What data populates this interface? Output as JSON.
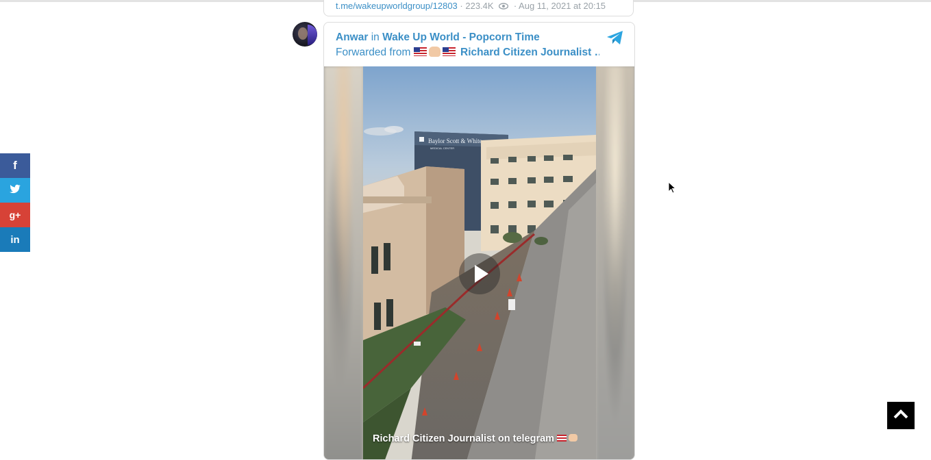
{
  "previous_post": {
    "link": "t.me/wakeupworldgroup/12803",
    "views": "223.4K",
    "date": "Aug 11, 2021 at 20:15"
  },
  "post": {
    "author": "Anwar",
    "in_label": "in",
    "group": "Wake Up World - Popcorn Time",
    "forwarded_label": "Forwarded from",
    "forwarded_source": "Richard Citizen Journalist …",
    "media": {
      "type": "video",
      "caption": "Richard Citizen Journalist on telegram",
      "building_sign": "Baylor Scott & White",
      "building_sign_sub": "MEDICAL CENTER"
    }
  },
  "share_bar": {
    "facebook": "f",
    "twitter": "twitter-icon",
    "googleplus": "g+",
    "linkedin": "in"
  },
  "icons": {
    "platform": "telegram-icon",
    "back_to_top": "chevron-up-icon",
    "views": "eye-icon"
  },
  "colors": {
    "link": "#3b8fc6",
    "facebook": "#3b5b9a",
    "twitter": "#2aa4df",
    "googleplus": "#d74237",
    "linkedin": "#1a7bb9",
    "telegram": "#2ca5e0"
  }
}
